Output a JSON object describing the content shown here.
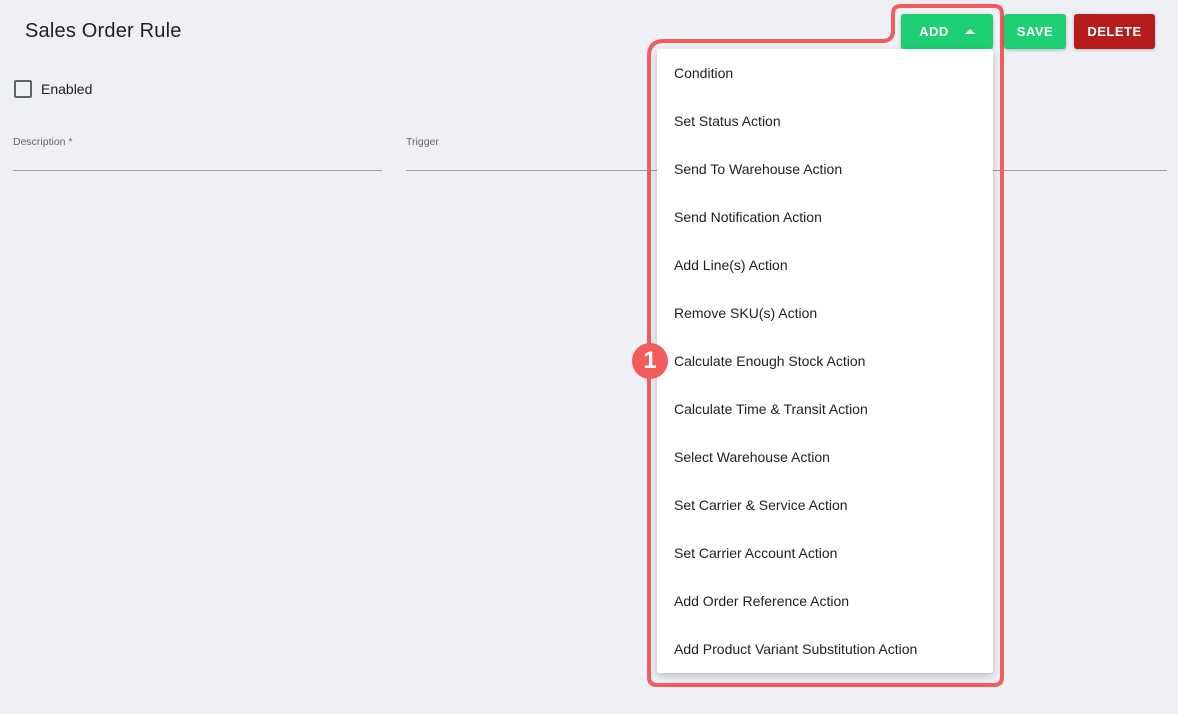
{
  "page": {
    "title": "Sales Order Rule"
  },
  "form": {
    "enabled_label": "Enabled",
    "description_label": "Description *",
    "trigger_label": "Trigger"
  },
  "toolbar": {
    "add_label": "ADD",
    "save_label": "SAVE",
    "delete_label": "DELETE"
  },
  "menu": {
    "items": [
      "Condition",
      "Set Status Action",
      "Send To Warehouse Action",
      "Send Notification Action",
      "Add Line(s) Action",
      "Remove SKU(s) Action",
      "Calculate Enough Stock Action",
      "Calculate Time & Transit Action",
      "Select Warehouse Action",
      "Set Carrier & Service Action",
      "Set Carrier Account Action",
      "Add Order Reference Action",
      "Add Product Variant Substitution Action"
    ]
  },
  "annotation": {
    "step": "1"
  },
  "colors": {
    "accent_green": "#1ed073",
    "danger_red": "#b71c1c",
    "highlight": "#f25c5c",
    "background": "#eef0f5"
  }
}
